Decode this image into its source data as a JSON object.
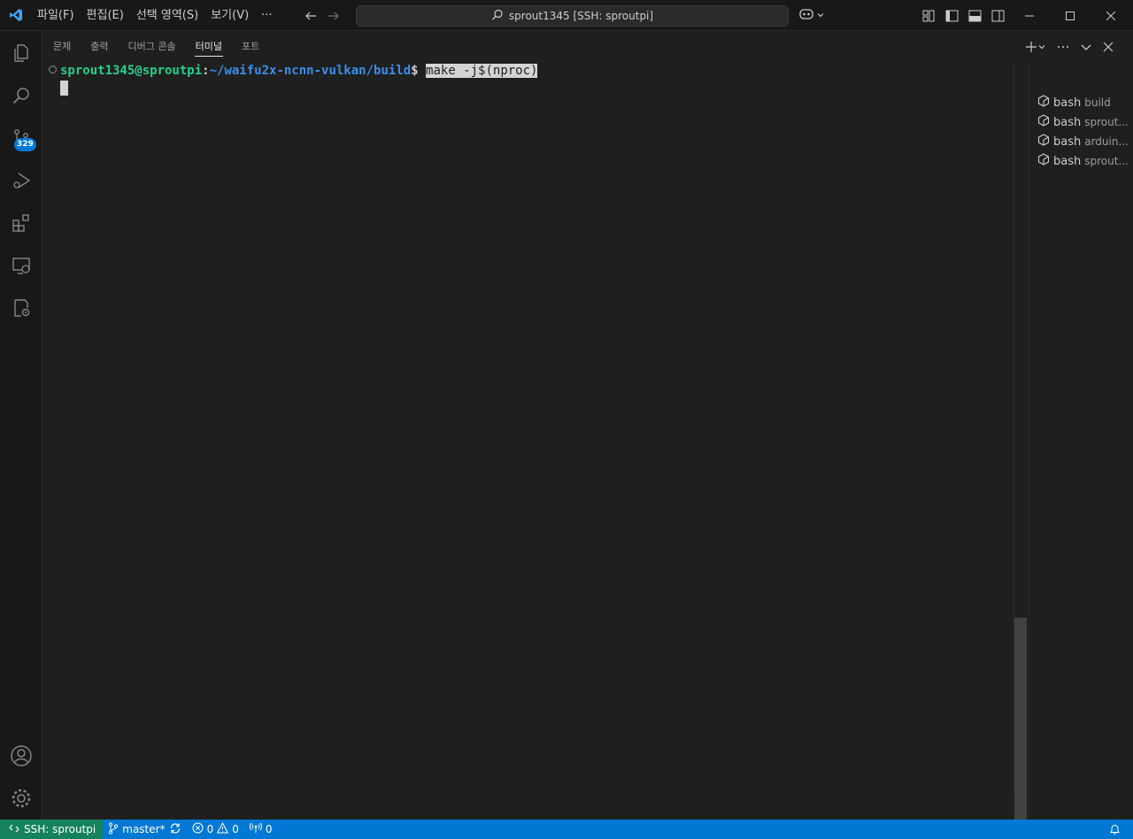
{
  "menubar": {
    "items": [
      "파일(F)",
      "편집(E)",
      "선택 영역(S)",
      "보기(V)",
      "···"
    ]
  },
  "command_center": {
    "text": "sprout1345 [SSH: sproutpi]",
    "icon": "search-icon"
  },
  "activitybar": {
    "items": [
      "explorer-icon",
      "search-icon",
      "source-control-icon",
      "run-debug-icon",
      "extensions-icon",
      "remote-explorer-icon",
      "remote-settings-icon"
    ],
    "source_control_badge": "329",
    "bottom": [
      "account-icon",
      "manage-gear-icon"
    ]
  },
  "panel": {
    "tabs": [
      "문제",
      "출력",
      "디버그 콘솔",
      "터미널",
      "포트"
    ],
    "active_tab": "터미널"
  },
  "terminal": {
    "user_host": "sprout1345@sproutpi",
    "colon": ":",
    "path": "~/waifu2x-ncnn-vulkan/build",
    "dollar": "$ ",
    "command": "make -j$(nproc)"
  },
  "terminal_list": [
    {
      "name": "bash",
      "desc": "build"
    },
    {
      "name": "bash",
      "desc": "sprout..."
    },
    {
      "name": "bash",
      "desc": "arduin..."
    },
    {
      "name": "bash",
      "desc": "sprout..."
    }
  ],
  "statusbar": {
    "remote": "SSH: sproutpi",
    "branch": "master*",
    "errors": "0",
    "warnings": "0",
    "ports": "0"
  },
  "colors": {
    "accent": "#0078d4",
    "remote": "#16825d",
    "prompt_user": "#23d18b",
    "prompt_path": "#3b8eea",
    "background": "#1f1f1f"
  }
}
